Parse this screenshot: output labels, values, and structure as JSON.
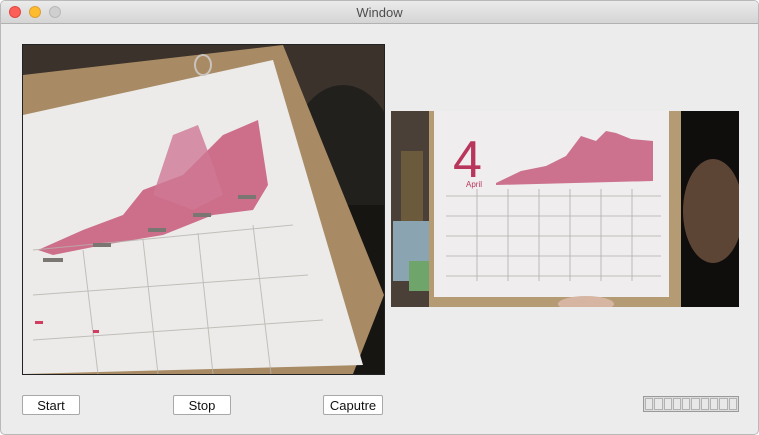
{
  "window": {
    "title": "Window"
  },
  "buttons": {
    "start": "Start",
    "stop": "Stop",
    "capture": "Caputre"
  },
  "progress": {
    "value": 0,
    "segments": 10
  },
  "thumbnail": {
    "calendar_number": "4",
    "calendar_month": "April"
  }
}
